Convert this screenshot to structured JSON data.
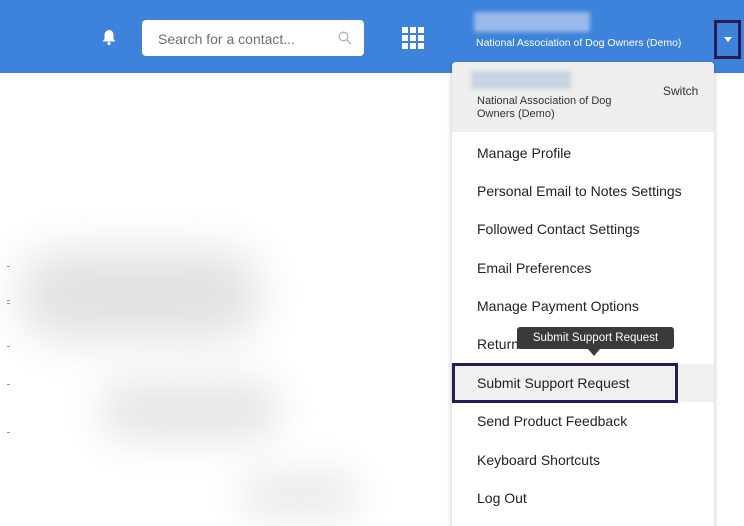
{
  "header": {
    "search": {
      "placeholder": "Search for a contact..."
    },
    "account": {
      "org_name": "National Association of Dog Owners (Demo)"
    },
    "icons": {
      "notifications": "bell-icon",
      "apps": "grid-icon",
      "search": "search-icon",
      "dropdown": "caret-down-icon"
    }
  },
  "menu": {
    "header": {
      "org_name": "National Association of Dog Owners (Demo)",
      "switch_label": "Switch"
    },
    "items": [
      {
        "label": "Manage Profile"
      },
      {
        "label": "Personal Email to Notes Settings"
      },
      {
        "label": "Followed Contact Settings"
      },
      {
        "label": "Email Preferences"
      },
      {
        "label": "Manage Payment Options"
      },
      {
        "label": "Return to Sell"
      },
      {
        "label": "Submit Support Request"
      },
      {
        "label": "Send Product Feedback"
      },
      {
        "label": "Keyboard Shortcuts"
      },
      {
        "label": "Log Out"
      }
    ]
  },
  "tooltip": {
    "text": "Submit Support Request"
  },
  "colors": {
    "topbar": "#3d83db",
    "highlight_border": "#2b1b55",
    "tooltip_bg": "#3a3a3a"
  }
}
